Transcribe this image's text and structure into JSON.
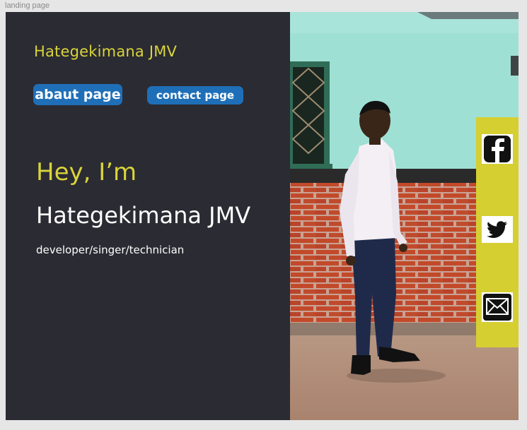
{
  "frame": {
    "label": "landing page"
  },
  "header": {
    "brand": "Hategekimana JMV"
  },
  "nav": {
    "about_label": "abaut page",
    "contact_label": "contact page"
  },
  "hero": {
    "greeting": "Hey, I’m",
    "name": "Hategekimana JMV",
    "roles": "developer/singer/technician"
  },
  "social": {
    "icons": [
      "facebook-icon",
      "twitter-icon",
      "mail-icon"
    ]
  },
  "colors": {
    "background": "#2b2b33",
    "accent_yellow": "#d9d43a",
    "button_blue": "#1f6fb8",
    "social_bar": "#d6cf32"
  }
}
